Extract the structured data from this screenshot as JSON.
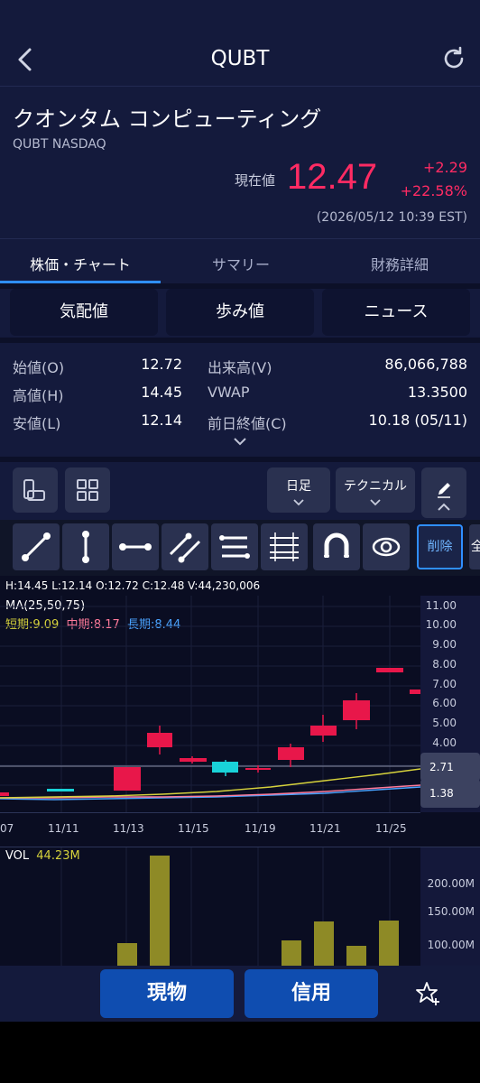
{
  "header": {
    "title": "QUBT"
  },
  "stock": {
    "name": "クオンタム コンピューティング",
    "sub": "QUBT NASDAQ",
    "price_label": "現在値",
    "price": "12.47",
    "change": "+2.29",
    "change_pct": "+22.58%",
    "timestamp": "(2026/05/12 10:39 EST)"
  },
  "tabs": [
    {
      "label": "株価・チャート",
      "active": true
    },
    {
      "label": "サマリー",
      "active": false
    },
    {
      "label": "財務詳細",
      "active": false
    }
  ],
  "segments": [
    "気配値",
    "歩み値",
    "ニュース"
  ],
  "stats": {
    "open_label": "始値(O)",
    "open": "12.72",
    "high_label": "高値(H)",
    "high": "14.45",
    "low_label": "安値(L)",
    "low": "12.14",
    "volume_label": "出来高(V)",
    "volume": "86,066,788",
    "vwap_label": "VWAP",
    "vwap": "13.3500",
    "prev_label": "前日終値(C)",
    "prev": "10.18 (05/11)"
  },
  "toolbar": {
    "period": "日足",
    "technical": "テクニカル"
  },
  "drawbar": {
    "delete": "削除",
    "all": "全"
  },
  "chart": {
    "ohlc": "H:14.45   L:12.14   O:12.72   C:12.48   V:44,230,006",
    "ma_title": "MA(25,50,75)",
    "ma_short": "短期:9.09",
    "ma_mid": "中期:8.17",
    "ma_long": "長期:8.44",
    "yticks": [
      "11.00",
      "10.00",
      "9.00",
      "8.00",
      "7.00",
      "6.00",
      "5.00",
      "4.00"
    ],
    "tag_upper": "2.71",
    "tag_lower": "1.38",
    "xticks": [
      "07",
      "11/11",
      "11/13",
      "11/15",
      "11/19",
      "11/21",
      "11/25"
    ],
    "colors": {
      "up": "#e8174a",
      "down": "#19d3d9",
      "ma_short": "#d6d23c",
      "ma_mid": "#ff7a9a",
      "ma_long": "#4aa3ff"
    }
  },
  "volume": {
    "label": "VOL",
    "value": "44.23M",
    "ticks": [
      "200.00M",
      "150.00M",
      "100.00M"
    ]
  },
  "bottom": {
    "cash": "現物",
    "margin": "信用"
  }
}
